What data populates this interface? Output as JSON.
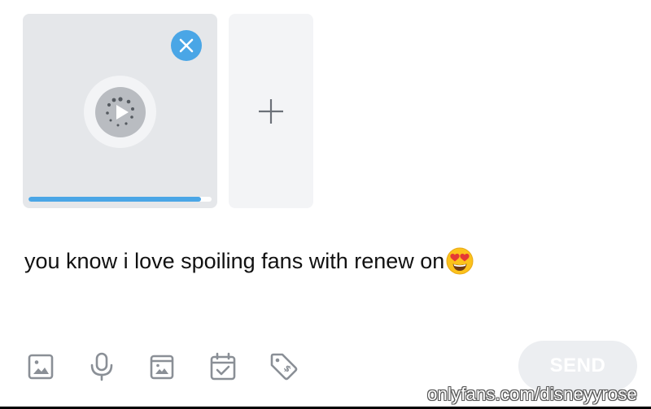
{
  "upload": {
    "progress_fraction": 0.94,
    "accent_color": "#4aa6e6",
    "remove_icon": "close-icon",
    "loader_icon": "play-loading-icon",
    "add_icon": "plus-icon"
  },
  "composer": {
    "message": "you know i love spoiling fans with renew on",
    "emoji": "heart-eyes-emoji"
  },
  "toolbar": {
    "icons": [
      "image-icon",
      "microphone-icon",
      "vault-icon",
      "calendar-check-icon",
      "price-tag-icon"
    ],
    "send_label": "SEND"
  },
  "watermark": {
    "text": "onlyfans.com/disneyyrose"
  }
}
